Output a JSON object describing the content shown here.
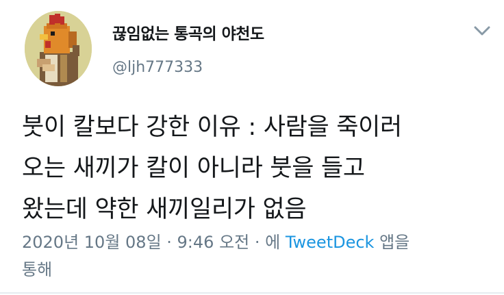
{
  "user": {
    "display_name": "끊임없는 통곡의 야천도",
    "handle": "@ljh777333",
    "avatar_icon": "pixel-bird-avatar"
  },
  "menu": {
    "icon": "chevron-down-icon"
  },
  "tweet": {
    "lines": [
      "붓이 칼보다 강한 이유 : 사람을 죽이러",
      "오는 새끼가 칼이 아니라 붓을 들고",
      "왔는데 약한 새끼일리가 없음"
    ]
  },
  "meta": {
    "timestamp": "2020년 10월 08일 · 9:46 오전 · 에",
    "client": "TweetDeck",
    "suffix": "앱을",
    "suffix_line2": "통해"
  },
  "colors": {
    "text": "#14171a",
    "secondary": "#657786",
    "link": "#1b95e0",
    "divider": "#e6ecf0"
  }
}
